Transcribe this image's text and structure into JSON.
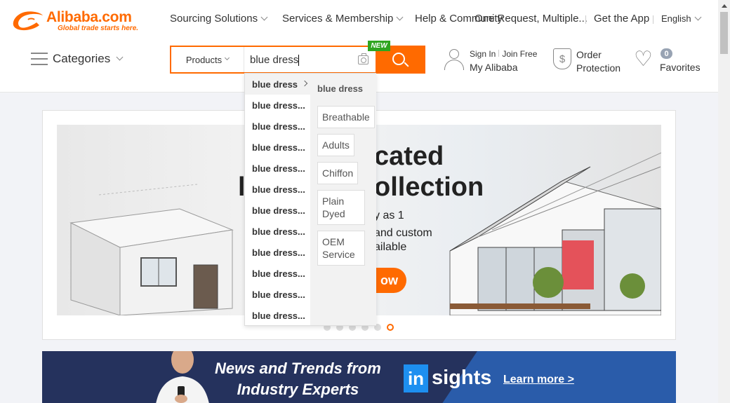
{
  "brand": {
    "name": "Alibaba.com",
    "tagline": "Global trade starts here.",
    "color": "#ff6a00"
  },
  "topnav": {
    "sourcing": "Sourcing Solutions",
    "services": "Services & Membership",
    "help": "Help & Community",
    "rfq": "One Request, Multiple...",
    "app": "Get the App",
    "language": "English"
  },
  "categories_label": "Categories",
  "search": {
    "category": "Products",
    "query": "blue dress",
    "badge": "NEW"
  },
  "account": {
    "sign_in": "Sign In",
    "join": "Join Free",
    "my_alibaba": "My Alibaba"
  },
  "order": {
    "line1": "Order",
    "line2": "Protection"
  },
  "favorites": {
    "count": "0",
    "label": "Favorites"
  },
  "suggestions": {
    "items": [
      "blue dress",
      "blue dress...",
      "blue dress...",
      "blue dress...",
      "blue dress...",
      "blue dress...",
      "blue dress...",
      "blue dress...",
      "blue dress...",
      "blue dress...",
      "blue dress...",
      "blue dress..."
    ],
    "panel_title": "blue dress",
    "chips": [
      "Breathable",
      "Adults",
      "Chiffon",
      "Plain Dyed",
      "OEM Service"
    ]
  },
  "banner": {
    "title_line1": "cated",
    "title_line2": "ollection",
    "partial_l": "l",
    "sub1": "y as 1",
    "sub2": "and custom",
    "sub3": "ailable",
    "cta": "ow",
    "slide_count": 6,
    "active_slide": 6
  },
  "insights": {
    "headline_line1": "News and Trends from",
    "headline_line2": "Industry Experts",
    "logo_in": "in",
    "logo_sights": "sights",
    "learn_more": "Learn more >"
  }
}
